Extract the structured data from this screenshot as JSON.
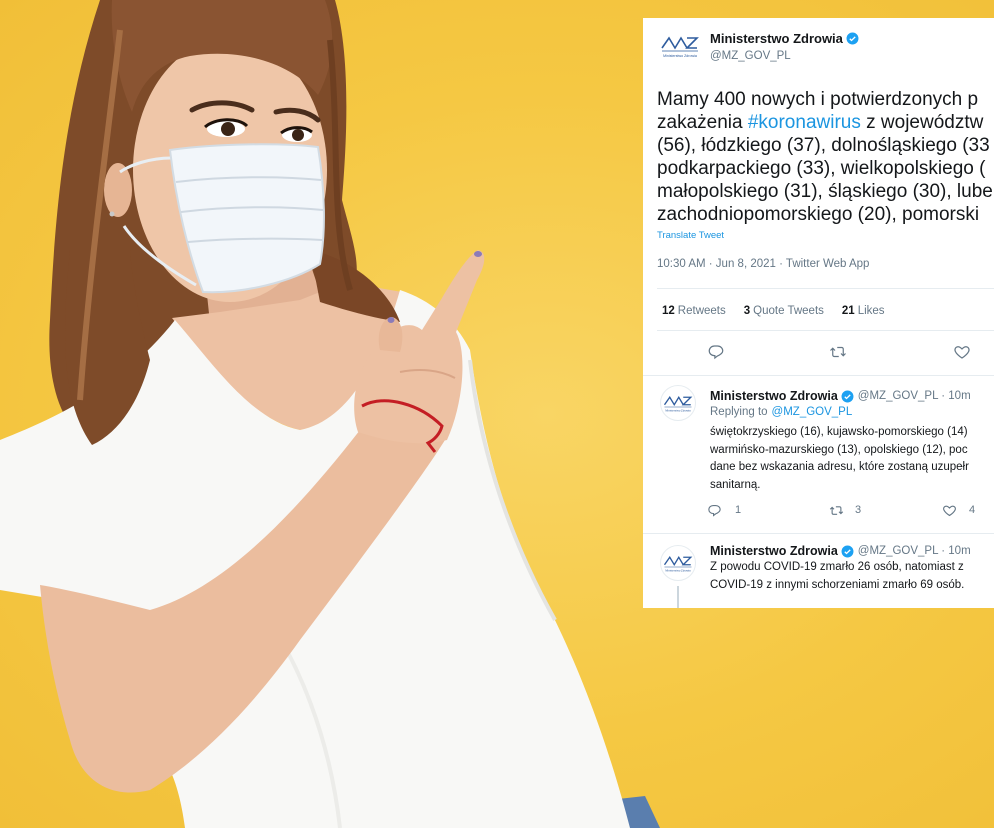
{
  "colors": {
    "background": "#F5C843",
    "card": "#FFFFFF",
    "text": "#14171A",
    "muted": "#657786",
    "link": "#1B95E0",
    "verified": "#1DA1F2",
    "divider": "#E6ECF0",
    "logo": "#2E5C9E"
  },
  "icons": {
    "reply": "reply-icon",
    "retweet": "retweet-icon",
    "like": "like-icon",
    "verified": "verified-badge-icon",
    "avatar": "mz-logo-icon"
  },
  "tweet": {
    "author": {
      "name": "Ministerstwo Zdrowia",
      "handle": "@MZ_GOV_PL",
      "verified": true,
      "logo_caption": "Ministerstwo Zdrowia"
    },
    "lines": [
      {
        "text": "Mamy 400 nowych i potwierdzonych p"
      },
      {
        "text": "zakażenia ",
        "hashtag": "#koronawirus",
        "after": " z województw"
      },
      {
        "text": "(56), łódzkiego (37), dolnośląskiego (33"
      },
      {
        "text": "podkarpackiego (33), wielkopolskiego ("
      },
      {
        "text": "małopolskiego (31), śląskiego (30), lube"
      },
      {
        "text": "zachodniopomorskiego (20), pomorski"
      }
    ],
    "translate_label": "Translate Tweet",
    "meta": "10:30 AM · Jun 8, 2021 · Twitter Web App",
    "stats": [
      {
        "count": "12",
        "label": "Retweets"
      },
      {
        "count": "3",
        "label": "Quote Tweets"
      },
      {
        "count": "21",
        "label": "Likes"
      }
    ]
  },
  "replies": [
    {
      "name": "Ministerstwo Zdrowia",
      "verified": true,
      "handle_time": "@MZ_GOV_PL · 10m",
      "replying_to": "Replying to",
      "replying_handle": "@MZ_GOV_PL",
      "lines": [
        "świętokrzyskiego (16), kujawsko-pomorskiego (14)",
        "warmińsko-mazurskiego (13), opolskiego (12), poc",
        "dane bez wskazania adresu, które zostaną uzupełr",
        "sanitarną."
      ],
      "counts": {
        "reply": "1",
        "retweet": "3",
        "like": "4"
      }
    },
    {
      "name": "Ministerstwo Zdrowia",
      "verified": true,
      "handle_time": "@MZ_GOV_PL · 10m",
      "lines": [
        "Z powodu COVID-19 zmarło 26 osób, natomiast z",
        "COVID-19 z innymi schorzeniami zmarło 69 osób."
      ]
    }
  ]
}
